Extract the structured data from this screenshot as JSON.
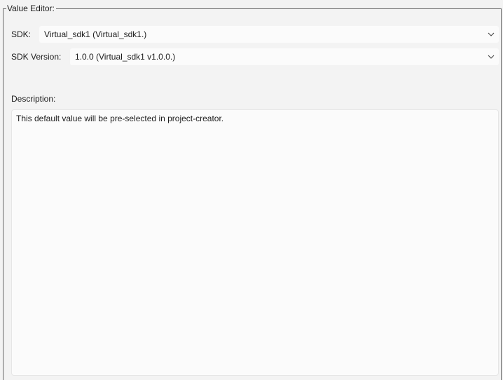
{
  "value_editor": {
    "title": "Value Editor:",
    "sdk": {
      "label": "SDK:",
      "selected": "Virtual_sdk1 (Virtual_sdk1.)"
    },
    "sdk_version": {
      "label": "SDK Version:",
      "selected": "1.0.0 (Virtual_sdk1 v1.0.0.)"
    },
    "description": {
      "label": "Description:",
      "text": "This default value will be pre-selected in project-creator."
    }
  },
  "icons": {
    "sdk_dropdown": "chevron-down-icon",
    "version_dropdown": "chevron-down-icon"
  },
  "colors": {
    "background": "#f3f3f3",
    "field_background": "#fbfbfb",
    "frame_border": "#6b6b6b",
    "text": "#1b1b1b"
  }
}
